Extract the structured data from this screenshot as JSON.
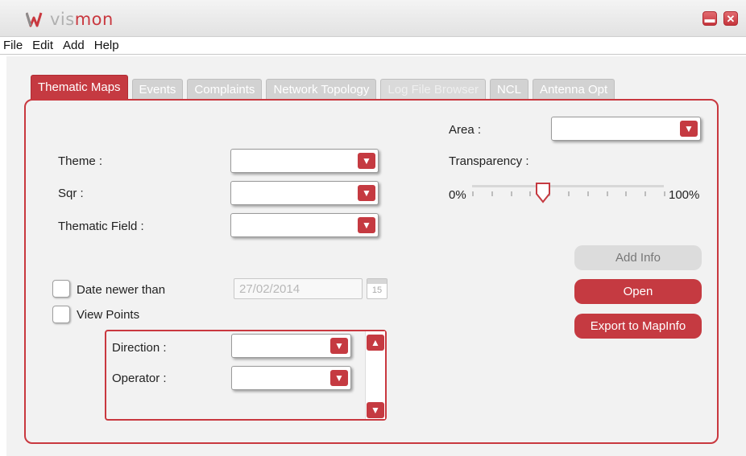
{
  "app": {
    "logo_text_a": "vis",
    "logo_text_b": "mon",
    "brand_color": "#c53a41"
  },
  "menu": [
    "File",
    "Edit",
    "Add",
    "Help"
  ],
  "tabs": [
    {
      "label": "Thematic Maps",
      "state": "active"
    },
    {
      "label": "Events",
      "state": "normal"
    },
    {
      "label": "Complaints",
      "state": "normal"
    },
    {
      "label": "Network Topology",
      "state": "normal"
    },
    {
      "label": "Log File Browser",
      "state": "disabled"
    },
    {
      "label": "NCL",
      "state": "normal"
    },
    {
      "label": "Antenna Opt",
      "state": "normal"
    }
  ],
  "form": {
    "theme_label": "Theme :",
    "sqr_label": "Sqr :",
    "thematic_field_label": "Thematic Field :",
    "area_label": "Area :",
    "transparency_label": "Transparency :",
    "slider_min": "0%",
    "slider_max": "100%",
    "transparency_value": 0.37,
    "date_newer_label": "Date newer than",
    "date_value": "27/02/2014",
    "calendar_day": "15",
    "view_points_label": "View Points",
    "direction_label": "Direction :",
    "operator_label": "Operator :"
  },
  "buttons": {
    "add_info": "Add Info",
    "open": "Open",
    "export": "Export to MapInfo"
  },
  "icons": {
    "dropdown": "chevron-down-icon",
    "scroll_up": "chevron-up-icon",
    "scroll_down": "chevron-down-icon",
    "calendar": "calendar-icon",
    "minimize": "minimize-icon",
    "close": "close-icon"
  }
}
